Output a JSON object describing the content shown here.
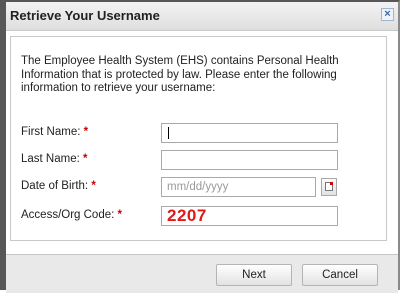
{
  "dialog": {
    "title": "Retrieve Your Username",
    "close_glyph": "×",
    "intro": "The Employee Health System (EHS) contains Personal Health Information that is protected by law. Please enter the following information to retrieve your username:"
  },
  "form": {
    "required_marker": "*",
    "first_name": {
      "label": "First Name:",
      "value": ""
    },
    "last_name": {
      "label": "Last Name:",
      "value": ""
    },
    "dob": {
      "label": "Date of Birth:",
      "value": "",
      "placeholder": "mm/dd/yyyy"
    },
    "access_code": {
      "label": "Access/Org Code:",
      "value": "2207"
    }
  },
  "buttons": {
    "next": "Next",
    "cancel": "Cancel"
  },
  "icons": {
    "close": "close-icon",
    "calendar": "calendar-icon"
  },
  "colors": {
    "required": "#cc0000",
    "code_value": "#e01818"
  }
}
